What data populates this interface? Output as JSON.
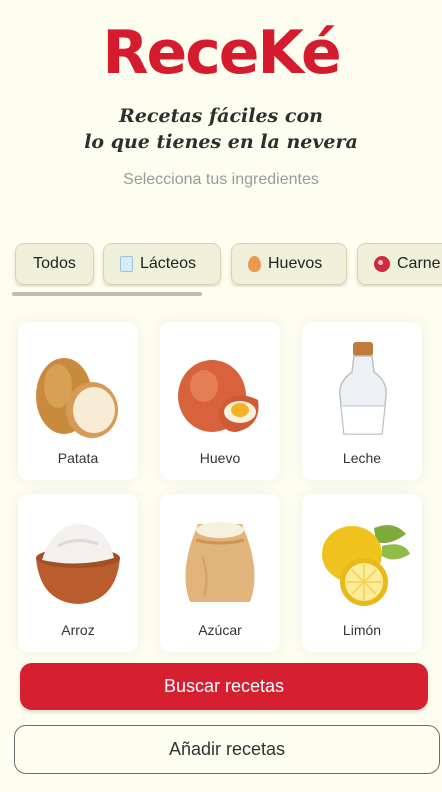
{
  "app": {
    "logo": "ReceKé",
    "tagline_line1": "Recetas fáciles con",
    "tagline_line2": "lo que tienes en la nevera",
    "subtitle": "Selecciona tus ingredientes"
  },
  "categories": [
    {
      "label": "Todos",
      "icon": "none"
    },
    {
      "label": "Lácteos",
      "icon": "milk-glass-icon"
    },
    {
      "label": "Huevos",
      "icon": "egg-icon"
    },
    {
      "label": "Carne",
      "icon": "meat-icon"
    }
  ],
  "ingredients": [
    {
      "label": "Patata",
      "icon": "potato-icon"
    },
    {
      "label": "Huevo",
      "icon": "egg-icon"
    },
    {
      "label": "Leche",
      "icon": "milk-bottle-icon"
    },
    {
      "label": "Arroz",
      "icon": "rice-bowl-icon"
    },
    {
      "label": "Azúcar",
      "icon": "sugar-sack-icon"
    },
    {
      "label": "Limón",
      "icon": "lemon-icon"
    }
  ],
  "actions": {
    "search_label": "Buscar recetas",
    "add_label": "Añadir recetas"
  },
  "colors": {
    "brand_red": "#d41c2e",
    "background": "#fdfdf0",
    "tab_bg": "#eff0d9"
  }
}
